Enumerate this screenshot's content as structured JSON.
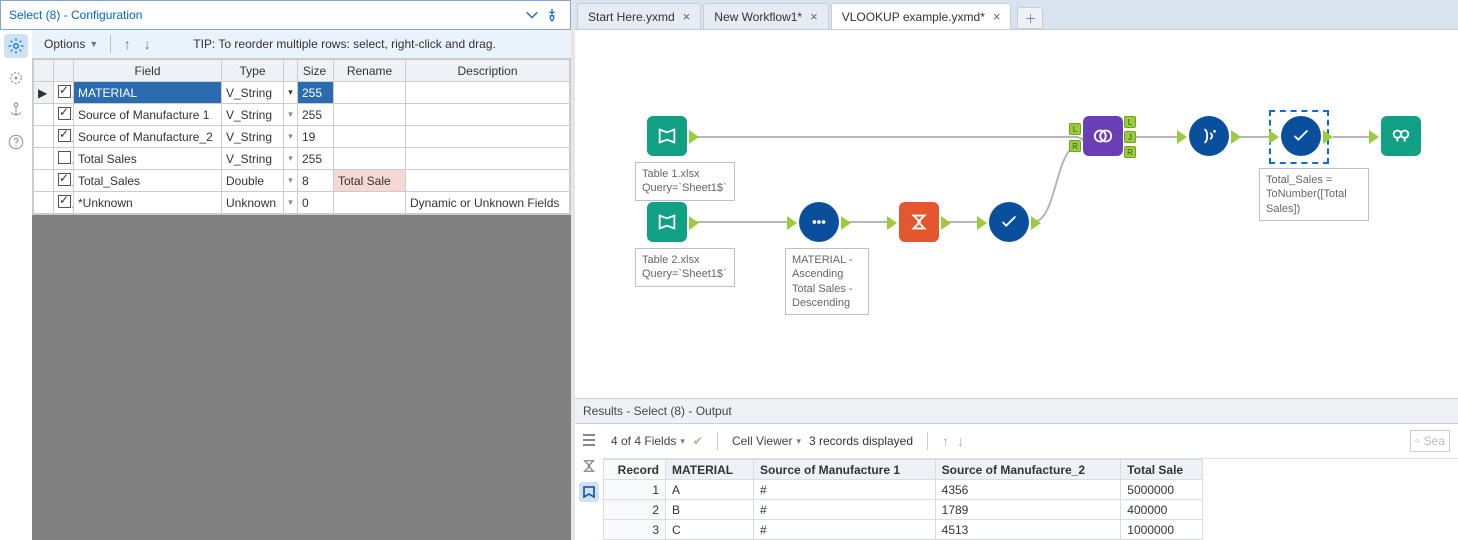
{
  "config": {
    "title": "Select (8) - Configuration",
    "options_label": "Options",
    "tip": "TIP: To reorder multiple rows: select, right-click and drag.",
    "columns": {
      "field": "Field",
      "type": "Type",
      "size": "Size",
      "rename": "Rename",
      "description": "Description"
    },
    "rows": [
      {
        "checked": true,
        "field": "MATERIAL",
        "type": "V_String",
        "size": "255",
        "rename": "",
        "desc": "",
        "selected": true
      },
      {
        "checked": true,
        "field": "Source of Manufacture 1",
        "type": "V_String",
        "size": "255",
        "rename": "",
        "desc": ""
      },
      {
        "checked": true,
        "field": "Source of Manufacture_2",
        "type": "V_String",
        "size": "19",
        "rename": "",
        "desc": ""
      },
      {
        "checked": false,
        "field": "Total Sales",
        "type": "V_String",
        "size": "255",
        "rename": "",
        "desc": ""
      },
      {
        "checked": true,
        "field": "Total_Sales",
        "type": "Double",
        "size": "8",
        "rename": "Total Sale",
        "desc": "",
        "rename_hl": true
      },
      {
        "checked": true,
        "field": "*Unknown",
        "type": "Unknown",
        "size": "0",
        "rename": "",
        "desc": "Dynamic or Unknown Fields"
      }
    ]
  },
  "tabs": [
    {
      "label": "Start Here.yxmd",
      "active": false
    },
    {
      "label": "New Workflow1*",
      "active": false
    },
    {
      "label": "VLOOKUP example.yxmd*",
      "active": true
    }
  ],
  "canvas": {
    "labels": {
      "table1": "Table 1.xlsx\nQuery=`Sheet1$`",
      "table2": "Table 2.xlsx\nQuery=`Sheet1$`",
      "sort": "MATERIAL - Ascending\nTotal Sales - Descending",
      "formula": "Total_Sales = ToNumber([Total Sales])"
    }
  },
  "results": {
    "title": "Results - Select (8) - Output",
    "fields_summary": "4 of 4 Fields",
    "cell_viewer": "Cell Viewer",
    "records_text": "3 records displayed",
    "search_placeholder": "Sea",
    "columns": [
      "Record",
      "MATERIAL",
      "Source of Manufacture 1",
      "Source of Manufacture_2",
      "Total Sale"
    ],
    "rows": [
      {
        "Record": "1",
        "MATERIAL": "A",
        "Source of Manufacture 1": "#",
        "Source of Manufacture_2": "4356",
        "Total Sale": "5000000"
      },
      {
        "Record": "2",
        "MATERIAL": "B",
        "Source of Manufacture 1": "#",
        "Source of Manufacture_2": "1789",
        "Total Sale": "400000"
      },
      {
        "Record": "3",
        "MATERIAL": "C",
        "Source of Manufacture 1": "#",
        "Source of Manufacture_2": "4513",
        "Total Sale": "1000000"
      }
    ]
  }
}
